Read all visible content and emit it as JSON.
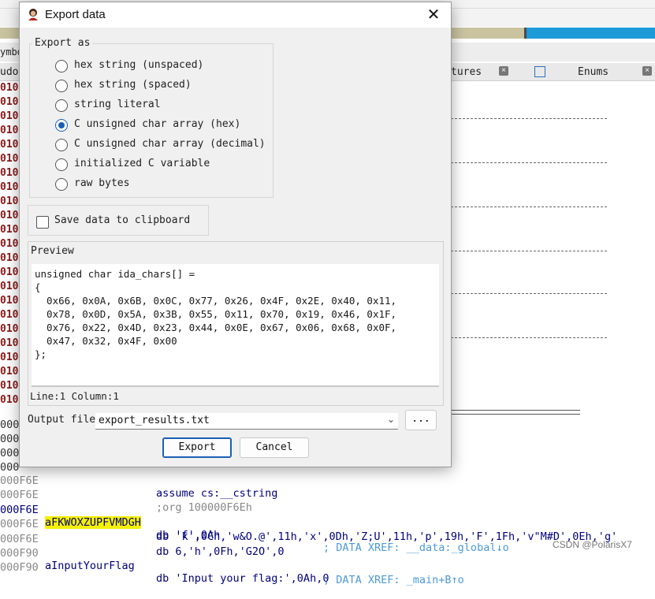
{
  "background": {
    "symbols_label": "ymbo",
    "pseudo_label": "udoc",
    "tabs": [
      {
        "label": "tures"
      },
      {
        "label": "Enums"
      }
    ],
    "tab_close_glyph": "×",
    "gutter_address": "0100",
    "gutter_address_short": "000",
    "asm_lines": [
      {
        "addr": "000F6E",
        "label": "",
        "instr": "assume cs:__cstring",
        "comment": "",
        "muted": true
      },
      {
        "addr": "000F6E",
        "label": "",
        "instr": ";org 100000F6Eh",
        "comment": "",
        "muted": true
      },
      {
        "addr": "000F6E",
        "label": "aFKWOXZUPFVMDGH",
        "instr": "db 'f',0Ah",
        "comment": "; DATA XREF: __data:_global↓o",
        "highlight": true
      },
      {
        "addr": "000F6E",
        "label": "",
        "instr": "db 'k',0Ch,'w&O.@',11h,'x',0Dh,'Z;U',11h,'p',19h,'F',1Fh,'v\"M#D',0Eh,'g'",
        "comment": ""
      },
      {
        "addr": "000F6E",
        "label": "",
        "instr": "db 6,'h',0Fh,'G2O',0",
        "comment": ""
      },
      {
        "addr": "000F90",
        "label": "aInputYourFlag",
        "instr": "db 'Input your flag:',0Ah,0",
        "comment": ""
      },
      {
        "addr": "000F90",
        "label": "",
        "instr": "",
        "comment": "; DATA XREF: _main+B↑o"
      }
    ],
    "watermark": "CSDN @PolarisX7",
    "colors": {
      "progress_gold": "#c9c3a0",
      "progress_blue": "#1c9ad8",
      "progress_dark": "#4a4a4a",
      "address_red": "#8b1a1a",
      "highlight_yellow": "#f4f000"
    }
  },
  "dialog": {
    "title": "Export data",
    "close_glyph": "✕",
    "export_as": {
      "label": "Export as",
      "options": [
        {
          "label": "hex string (unspaced)",
          "selected": false
        },
        {
          "label": "hex string (spaced)",
          "selected": false
        },
        {
          "label": "string literal",
          "selected": false
        },
        {
          "label": "C unsigned char array (hex)",
          "selected": true
        },
        {
          "label": "C unsigned char array (decimal)",
          "selected": false
        },
        {
          "label": "initialized C variable",
          "selected": false
        },
        {
          "label": "raw bytes",
          "selected": false
        }
      ]
    },
    "save_to_clipboard": {
      "label": "Save data to clipboard",
      "checked": false
    },
    "preview": {
      "label": "Preview",
      "lines": [
        "unsigned char ida_chars[] =",
        "{",
        "  0x66, 0x0A, 0x6B, 0x0C, 0x77, 0x26, 0x4F, 0x2E, 0x40, 0x11,",
        "  0x78, 0x0D, 0x5A, 0x3B, 0x55, 0x11, 0x70, 0x19, 0x46, 0x1F,",
        "  0x76, 0x22, 0x4D, 0x23, 0x44, 0x0E, 0x67, 0x06, 0x68, 0x0F,",
        "  0x47, 0x32, 0x4F, 0x00",
        "};"
      ],
      "status": "Line:1  Column:1"
    },
    "output_file": {
      "label": "Output file",
      "value": "export_results.txt",
      "browse_label": "..."
    },
    "buttons": {
      "export": "Export",
      "cancel": "Cancel"
    },
    "accent_color": "#1a5fb4"
  }
}
